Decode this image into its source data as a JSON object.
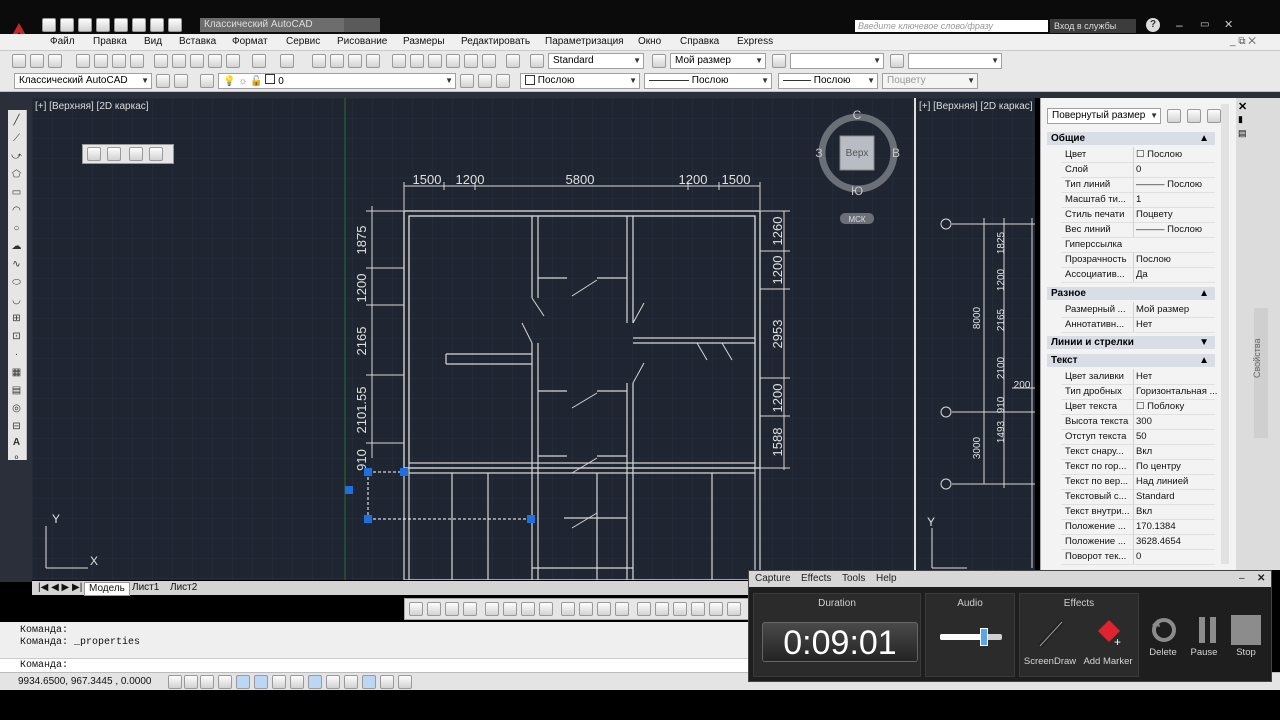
{
  "window": {
    "title": "Классический AutoCAD",
    "search_placeholder": "Введите ключевое слово/фразу",
    "signin": "Вход в службы",
    "help": "?"
  },
  "menu": [
    "Файл",
    "Правка",
    "Вид",
    "Вставка",
    "Формат",
    "Сервис",
    "Рисование",
    "Размеры",
    "Редактировать",
    "Параметризация",
    "Окно",
    "Справка",
    "Express"
  ],
  "toolbar1": {
    "text_style": "Standard",
    "dim_style": "Мой размер"
  },
  "toolbar2": {
    "workspace": "Классический AutoCAD",
    "layer": "0",
    "color": "Послою",
    "linetype": "Послою",
    "lineweight": "Послою",
    "plotstyle": "Поцвету"
  },
  "viewport_main": {
    "label": "[+] [Верхняя] [2D каркас]",
    "ucs_x": "X",
    "ucs_y": "Y",
    "viewcube": {
      "n": "С",
      "s": "Ю",
      "w": "З",
      "e": "В",
      "face": "Верх",
      "wcs": "МСК"
    }
  },
  "drawing": {
    "top_dims": [
      "1500",
      "1200",
      "5800",
      "1200",
      "1500"
    ],
    "left_dims": [
      "1875",
      "1200",
      "2165",
      "2101.55",
      "910"
    ],
    "right_dims": [
      "1260",
      "1200",
      "2953",
      "1200",
      "1588"
    ]
  },
  "viewport_secondary": {
    "label": "[+] [Верхняя] [2D каркас]",
    "dims": [
      "1825",
      "1200",
      "2165",
      "2100",
      "910",
      "1493",
      "8000",
      "3000",
      "200"
    ],
    "ucs_y": "Y"
  },
  "properties": {
    "selector": "Повернутый размер",
    "side_tab": "Свойства",
    "categories": [
      {
        "name": "Общие",
        "rows": [
          {
            "name": "Цвет",
            "value": "☐ Послою"
          },
          {
            "name": "Слой",
            "value": "0"
          },
          {
            "name": "Тип линий",
            "value": "——— Послою"
          },
          {
            "name": "Масштаб ти...",
            "value": "1"
          },
          {
            "name": "Стиль печати",
            "value": "Поцвету"
          },
          {
            "name": "Вес линий",
            "value": "——— Послою"
          },
          {
            "name": "Гиперссылка",
            "value": ""
          },
          {
            "name": "Прозрачность",
            "value": "Послою"
          },
          {
            "name": "Ассоциатив...",
            "value": "Да"
          }
        ]
      },
      {
        "name": "Разное",
        "rows": [
          {
            "name": "Размерный ...",
            "value": "Мой размер"
          },
          {
            "name": "Аннотативн...",
            "value": "Нет"
          }
        ]
      },
      {
        "name": "Линии и стрелки",
        "rows": []
      },
      {
        "name": "Текст",
        "rows": [
          {
            "name": "Цвет заливки",
            "value": "Нет"
          },
          {
            "name": "Тип дробных",
            "value": "Горизонтальная ..."
          },
          {
            "name": "Цвет текста",
            "value": "☐ Поблоку"
          },
          {
            "name": "Высота текста",
            "value": "300"
          },
          {
            "name": "Отступ текста",
            "value": "50"
          },
          {
            "name": "Текст снару...",
            "value": "Вкл"
          },
          {
            "name": "Текст по гор...",
            "value": "По центру"
          },
          {
            "name": "Текст по вер...",
            "value": "Над линией"
          },
          {
            "name": "Текстовый с...",
            "value": "Standard"
          },
          {
            "name": "Текст внутри...",
            "value": "Вкл"
          },
          {
            "name": "Положение ...",
            "value": "170.1384"
          },
          {
            "name": "Положение ...",
            "value": "3628.4654"
          },
          {
            "name": "Поворот тек...",
            "value": "0"
          }
        ]
      }
    ]
  },
  "layout_tabs": [
    "Модель",
    "Лист1",
    "Лист2"
  ],
  "command_line": [
    "Команда:",
    "Команда:  _properties",
    "Команда:"
  ],
  "status": {
    "coords": "9934.6500, 967.3445 , 0.0000"
  },
  "recorder": {
    "menu": [
      "Capture",
      "Effects",
      "Tools",
      "Help"
    ],
    "duration_label": "Duration",
    "timer": "0:09:01",
    "audio_label": "Audio",
    "audio_level": 0.7,
    "effects_label": "Effects",
    "screendraw": "ScreenDraw",
    "add_marker": "Add Marker",
    "delete": "Delete",
    "pause": "Pause",
    "stop": "Stop"
  }
}
